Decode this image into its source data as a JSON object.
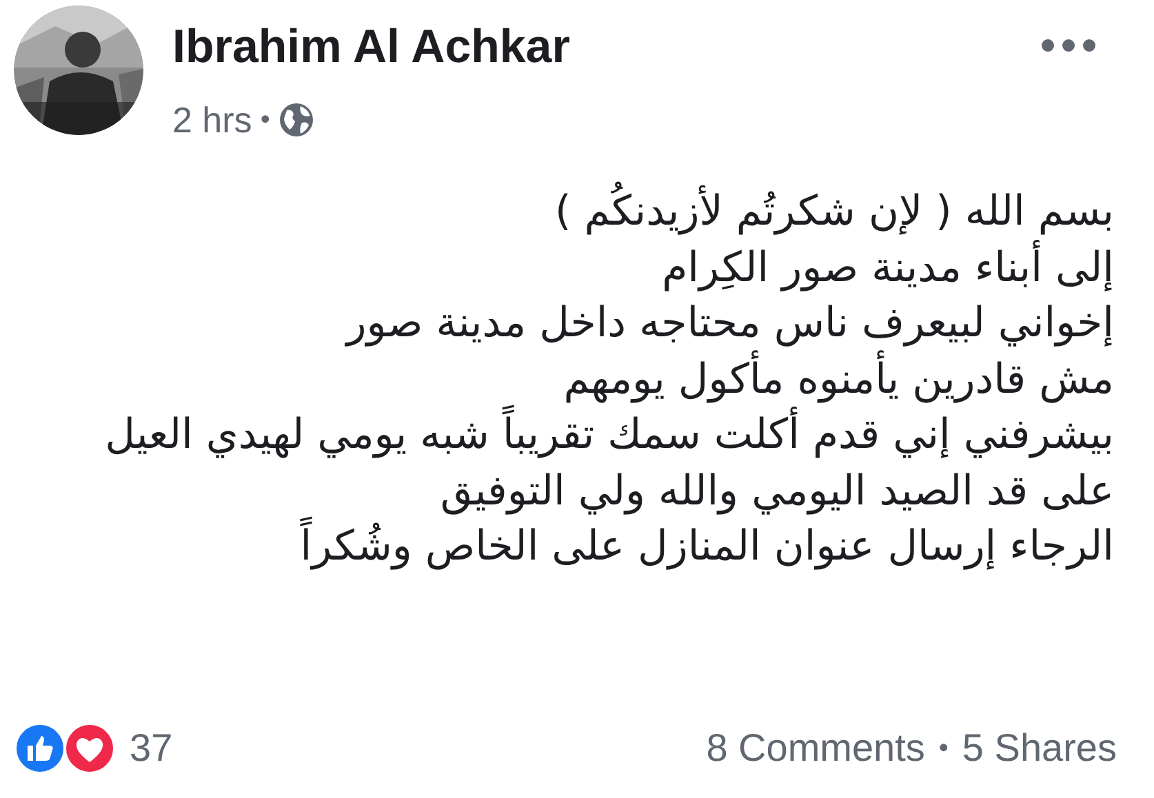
{
  "author": {
    "name": "Ibrahim Al Achkar"
  },
  "meta": {
    "time": "2 hrs",
    "separator": "•"
  },
  "body": {
    "lines": [
      "بسم الله ( لإن شكرتُم لأزيدنكُم )",
      "إلى أبناء مدينة صور الكِرام",
      "إخواني لبيعرف ناس محتاجه داخل مدينة صور",
      "مش قادرين يأمنوه مأكول يومهم",
      "بيشرفني إني قدم أكلت سمك تقريباً شبه يومي لهيدي العيل",
      "على قد الصيد اليومي والله ولي التوفيق",
      "الرجاء إرسال عنوان المنازل على الخاص وشُكراً"
    ]
  },
  "reactions": {
    "count": "37"
  },
  "stats": {
    "comments": "8 Comments",
    "separator": "•",
    "shares": "5 Shares"
  }
}
